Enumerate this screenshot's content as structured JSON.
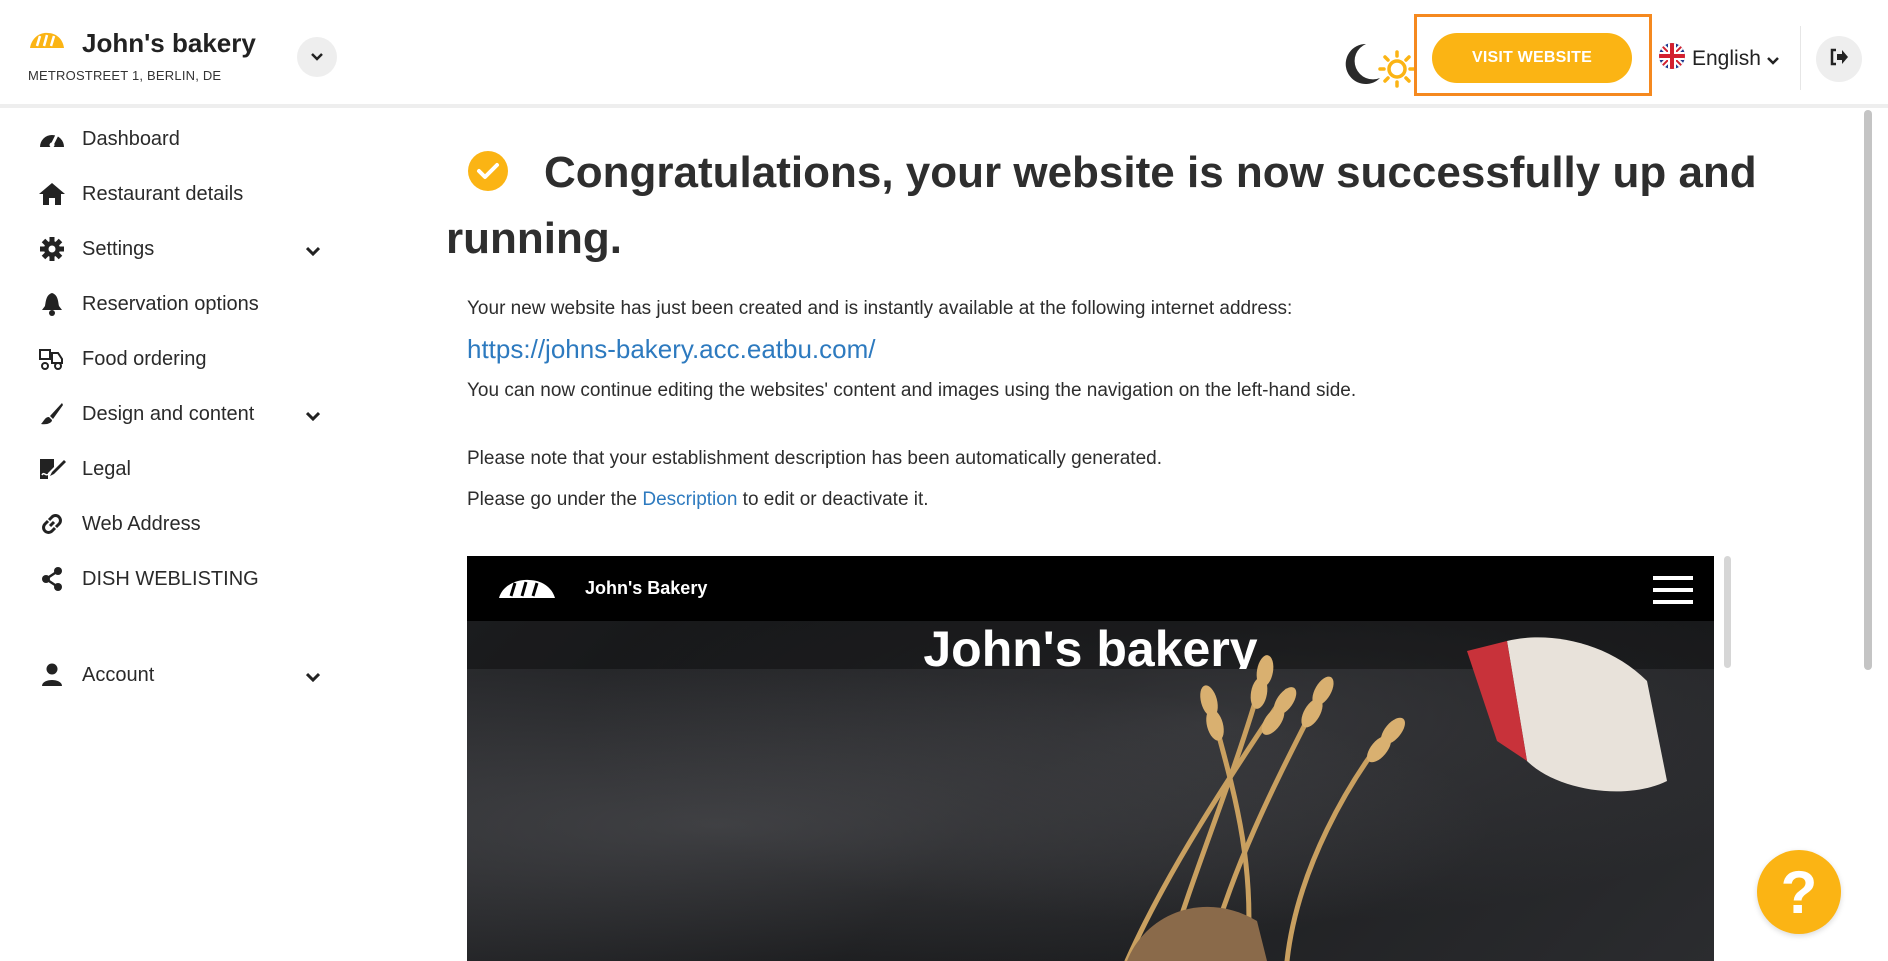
{
  "brand": {
    "name": "John's bakery",
    "address": "METROSTREET 1, BERLIN, DE"
  },
  "header": {
    "visit_label": "VISIT WEBSITE",
    "language": "English"
  },
  "sidebar": {
    "items": [
      {
        "label": "Dashboard",
        "icon": "dashboard-icon"
      },
      {
        "label": "Restaurant details",
        "icon": "home-icon"
      },
      {
        "label": "Settings",
        "icon": "gear-icon"
      },
      {
        "label": "Reservation options",
        "icon": "bell-icon"
      },
      {
        "label": "Food ordering",
        "icon": "delivery-icon"
      },
      {
        "label": "Design and content",
        "icon": "brush-icon"
      },
      {
        "label": "Legal",
        "icon": "signature-icon"
      },
      {
        "label": "Web Address",
        "icon": "link-icon"
      },
      {
        "label": "DISH WEBLISTING",
        "icon": "share-icon"
      },
      {
        "label": "Account",
        "icon": "user-icon"
      }
    ]
  },
  "main": {
    "title": "Congratulations, your website is now successfully up and running.",
    "intro": "Your new website has just been created and is instantly available at the following internet address:",
    "url": "https://johns-bakery.acc.eatbu.com/",
    "continue_text": "You can now continue editing the websites' content and images using the navigation on the left-hand side.",
    "note": "Please note that your establishment description has been automatically generated.",
    "desc_prefix": "Please go under the ",
    "desc_link": "Description",
    "desc_suffix": " to edit or deactivate it."
  },
  "preview": {
    "brand": "John's Bakery",
    "hero_title": "John's bakery"
  },
  "help": {
    "label": "?"
  },
  "colors": {
    "accent": "#fbb414",
    "highlight": "#f5891f",
    "link": "#2d7abf"
  }
}
